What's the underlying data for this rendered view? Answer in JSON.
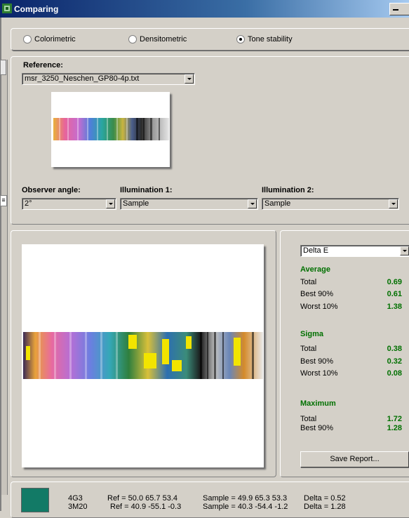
{
  "window": {
    "title": "Comparing"
  },
  "modes": [
    {
      "label": "Colorimetric",
      "selected": false
    },
    {
      "label": "Densitometric",
      "selected": false
    },
    {
      "label": "Tone stability",
      "selected": true
    }
  ],
  "reference": {
    "label": "Reference:",
    "file": "msr_3250_Neschen_GP80-4p.txt"
  },
  "observer": {
    "label": "Observer angle:",
    "value": "2°"
  },
  "illumination1": {
    "label": "Illumination 1:",
    "value": "Sample"
  },
  "illumination2": {
    "label": "Illumination 2:",
    "value": "Sample"
  },
  "stats": {
    "metric": "Delta E",
    "average": {
      "title": "Average",
      "rows": [
        {
          "label": "Total",
          "value": "0.69"
        },
        {
          "label": "Best 90%",
          "value": "0.61"
        },
        {
          "label": "Worst 10%",
          "value": "1.38"
        }
      ]
    },
    "sigma": {
      "title": "Sigma",
      "rows": [
        {
          "label": "Total",
          "value": "0.38"
        },
        {
          "label": "Best 90%",
          "value": "0.32"
        },
        {
          "label": "Worst 10%",
          "value": "0.08"
        }
      ]
    },
    "maximum": {
      "title": "Maximum",
      "rows": [
        {
          "label": "Total",
          "value": "1.72"
        },
        {
          "label": "Best 90%",
          "value": "1.28"
        }
      ]
    },
    "save_label": "Save Report..."
  },
  "patches": [
    {
      "id": "4G3",
      "ref": "Ref = 50.0  65.7  53.4",
      "sample": "Sample = 49.9  65.3  53.3",
      "delta": "Delta = 0.52"
    },
    {
      "id": "3M20",
      "ref": "Ref = 40.9 -55.1  -0.3",
      "sample": "Sample = 40.3 -54.4  -1.2",
      "delta": "Delta = 1.28"
    }
  ],
  "colors": {
    "swatch": "#127a66",
    "stat_green": "#007000",
    "titlebar": "#0a246a"
  }
}
